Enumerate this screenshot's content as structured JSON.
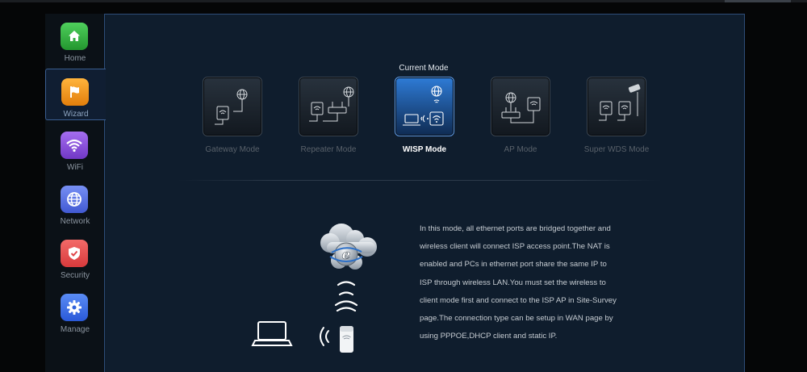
{
  "sidebar": {
    "items": [
      {
        "label": "Home",
        "icon": "home-icon",
        "color": "#3bb54a"
      },
      {
        "label": "Wizard",
        "icon": "flag-icon",
        "color": "#f39c1c",
        "active": true
      },
      {
        "label": "WiFi",
        "icon": "wifi-icon",
        "color": "#8e4fd8"
      },
      {
        "label": "Network",
        "icon": "globe-icon",
        "color": "#5b74e6"
      },
      {
        "label": "Security",
        "icon": "shield-icon",
        "color": "#e85354"
      },
      {
        "label": "Manage",
        "icon": "gear-icon",
        "color": "#3b6fe6"
      }
    ]
  },
  "main": {
    "current_mode_label": "Current Mode",
    "modes": [
      {
        "label": "Gateway Mode",
        "active": false
      },
      {
        "label": "Repeater Mode",
        "active": false
      },
      {
        "label": "WISP Mode",
        "active": true
      },
      {
        "label": "AP Mode",
        "active": false
      },
      {
        "label": "Super WDS Mode",
        "active": false
      }
    ],
    "description": "In this mode, all ethernet ports are bridged together and wireless client will connect ISP access point.The NAT is enabled and PCs in ethernet port share the same IP to ISP through wireless LAN.You must set the wireless to client mode first and connect to the ISP AP in Site-Survey page.The connection type can be setup in WAN page by using PPPOE,DHCP client and static IP."
  },
  "colors": {
    "accent": "#2e7bd6",
    "panel_bg": "#0f1d2d",
    "panel_border": "#2d4d78"
  }
}
